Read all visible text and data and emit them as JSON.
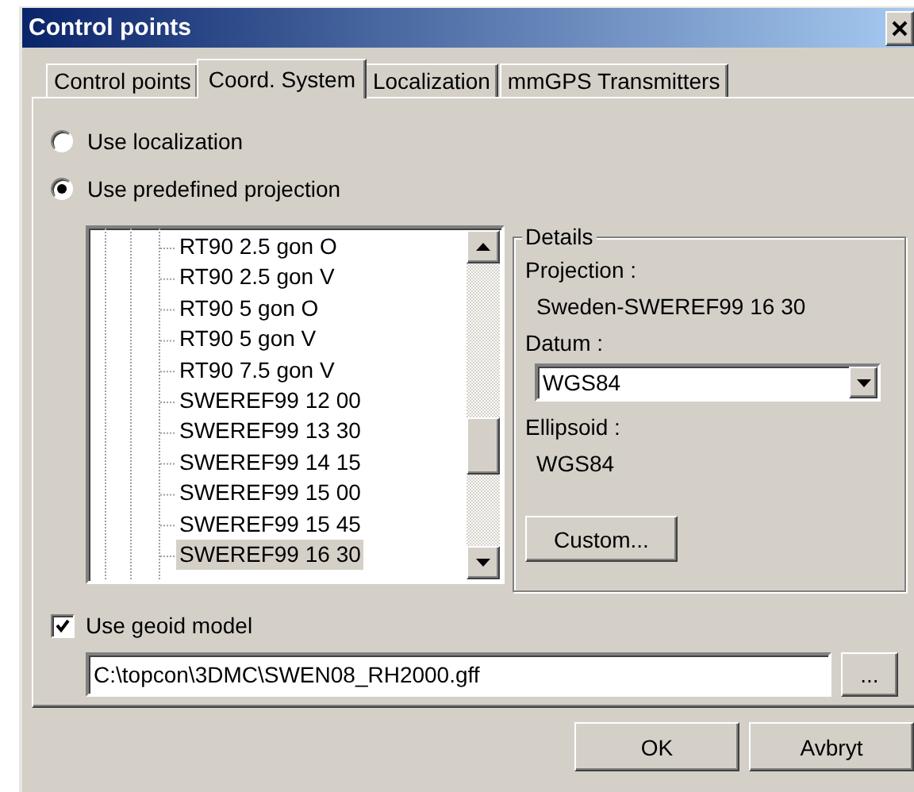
{
  "window": {
    "title": "Control points"
  },
  "tabs": [
    {
      "label": "Control points",
      "selected": false
    },
    {
      "label": "Coord. System",
      "selected": true
    },
    {
      "label": "Localization",
      "selected": false
    },
    {
      "label": "mmGPS Transmitters",
      "selected": false
    }
  ],
  "source_options": [
    {
      "label": "Use localization",
      "selected": false
    },
    {
      "label": "Use predefined projection",
      "selected": true
    }
  ],
  "projection_tree": {
    "items": [
      {
        "label": "RT90 2.5 gon O",
        "selected": false
      },
      {
        "label": "RT90 2.5 gon V",
        "selected": false
      },
      {
        "label": "RT90 5 gon O",
        "selected": false
      },
      {
        "label": "RT90 5 gon V",
        "selected": false
      },
      {
        "label": "RT90 7.5 gon V",
        "selected": false
      },
      {
        "label": "SWEREF99 12 00",
        "selected": false
      },
      {
        "label": "SWEREF99 13 30",
        "selected": false
      },
      {
        "label": "SWEREF99 14 15",
        "selected": false
      },
      {
        "label": "SWEREF99 15 00",
        "selected": false
      },
      {
        "label": "SWEREF99 15 45",
        "selected": false
      },
      {
        "label": "SWEREF99 16 30",
        "selected": true
      }
    ]
  },
  "details": {
    "title": "Details",
    "projection_label": "Projection :",
    "projection_value": "Sweden-SWEREF99 16 30",
    "datum_label": "Datum :",
    "datum_value": "WGS84",
    "ellipsoid_label": "Ellipsoid :",
    "ellipsoid_value": "WGS84",
    "custom_button": "Custom..."
  },
  "geoid": {
    "label": "Use geoid model",
    "checked": true,
    "path": "C:\\topcon\\3DMC\\SWEN08_RH2000.gff",
    "browse_button": "..."
  },
  "buttons": [
    "OK",
    "Avbryt"
  ]
}
